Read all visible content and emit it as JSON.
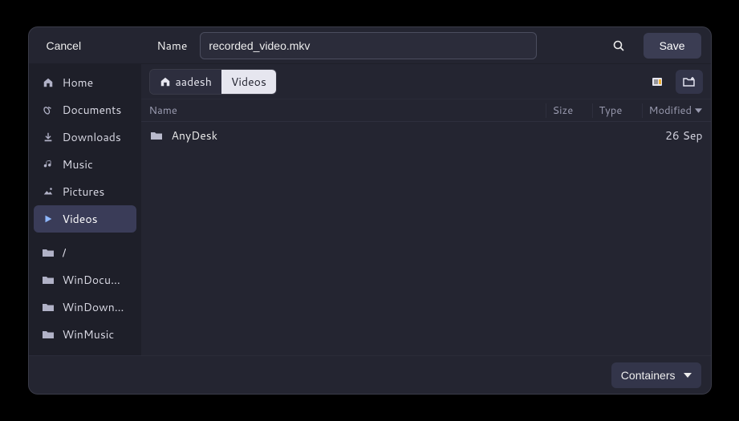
{
  "header": {
    "cancel_label": "Cancel",
    "name_label": "Name",
    "filename_value": "recorded_video.mkv",
    "save_label": "Save"
  },
  "sidebar": {
    "items": [
      {
        "icon": "home",
        "label": "Home",
        "active": false
      },
      {
        "icon": "documents",
        "label": "Documents",
        "active": false
      },
      {
        "icon": "downloads",
        "label": "Downloads",
        "active": false
      },
      {
        "icon": "music",
        "label": "Music",
        "active": false
      },
      {
        "icon": "pictures",
        "label": "Pictures",
        "active": false
      },
      {
        "icon": "videos",
        "label": "Videos",
        "active": true
      }
    ],
    "mounts": [
      {
        "icon": "folder",
        "label": "/"
      },
      {
        "icon": "folder",
        "label": "WinDocu…"
      },
      {
        "icon": "folder",
        "label": "WinDown…"
      },
      {
        "icon": "folder",
        "label": "WinMusic"
      }
    ]
  },
  "breadcrumb": {
    "home_label": "aadesh",
    "current_label": "Videos"
  },
  "columns": {
    "name": "Name",
    "size": "Size",
    "type": "Type",
    "modified": "Modified"
  },
  "files": [
    {
      "icon": "folder",
      "name": "AnyDesk",
      "size": "",
      "type": "",
      "modified": "26 Sep"
    }
  ],
  "footer": {
    "filter_label": "Containers"
  }
}
